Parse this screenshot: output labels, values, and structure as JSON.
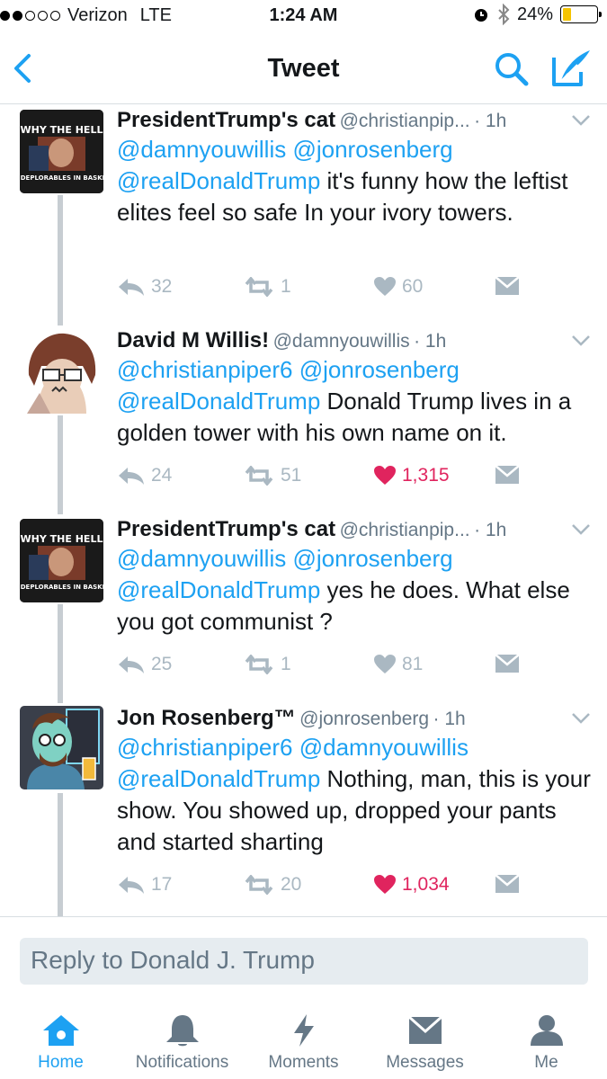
{
  "status": {
    "carrier": "Verizon",
    "network": "LTE",
    "time": "1:24 AM",
    "battery": "24%",
    "battery_level": 0.24
  },
  "nav": {
    "title": "Tweet"
  },
  "tweets": [
    {
      "name": "PresidentTrump's cat",
      "handle": "@christianpip...",
      "time": "1h",
      "mentions": [
        "@damnyouwillis",
        "@jonrosenberg",
        "@realDonaldTrump"
      ],
      "text": "it's funny how the leftist elites feel so safe In  your ivory towers.",
      "replies": "32",
      "retweets": "1",
      "likes": "60",
      "liked": false,
      "avatar_line1": "WHY THE HELL",
      "avatar_line2": "ARE DEPLORABLES IN BASKETS?"
    },
    {
      "name": "David M Willis!",
      "handle": "@damnyouwillis",
      "time": "1h",
      "mentions": [
        "@christianpiper6",
        "@jonrosenberg",
        "@realDonaldTrump"
      ],
      "text": "Donald Trump lives in a golden tower with his own name on it.",
      "replies": "24",
      "retweets": "51",
      "likes": "1,315",
      "liked": true
    },
    {
      "name": "PresidentTrump's cat",
      "handle": "@christianpip...",
      "time": "1h",
      "mentions": [
        "@damnyouwillis",
        "@jonrosenberg",
        "@realDonaldTrump"
      ],
      "text": "yes he does. What else you got communist ?",
      "replies": "25",
      "retweets": "1",
      "likes": "81",
      "liked": false,
      "avatar_line1": "WHY THE HELL",
      "avatar_line2": "ARE DEPLORABLES IN BASKETS?"
    },
    {
      "name": "Jon Rosenberg™",
      "handle": "@jonrosenberg",
      "time": "1h",
      "mentions": [
        "@christianpiper6",
        "@damnyouwillis",
        "@realDonaldTrump"
      ],
      "text": "Nothing, man, this is your show. You showed up, dropped your pants and started sharting",
      "replies": "17",
      "retweets": "20",
      "likes": "1,034",
      "liked": true
    }
  ],
  "reply": {
    "placeholder": "Reply to Donald J. Trump"
  },
  "tabs": [
    {
      "label": "Home",
      "icon": "home-icon",
      "active": true
    },
    {
      "label": "Notifications",
      "icon": "bell-icon",
      "active": false
    },
    {
      "label": "Moments",
      "icon": "lightning-icon",
      "active": false
    },
    {
      "label": "Messages",
      "icon": "envelope-icon",
      "active": false
    },
    {
      "label": "Me",
      "icon": "person-icon",
      "active": false
    }
  ],
  "colors": {
    "accent": "#1da1f2",
    "like": "#e0245e",
    "muted": "#aab8c2",
    "secondary_text": "#657786"
  }
}
